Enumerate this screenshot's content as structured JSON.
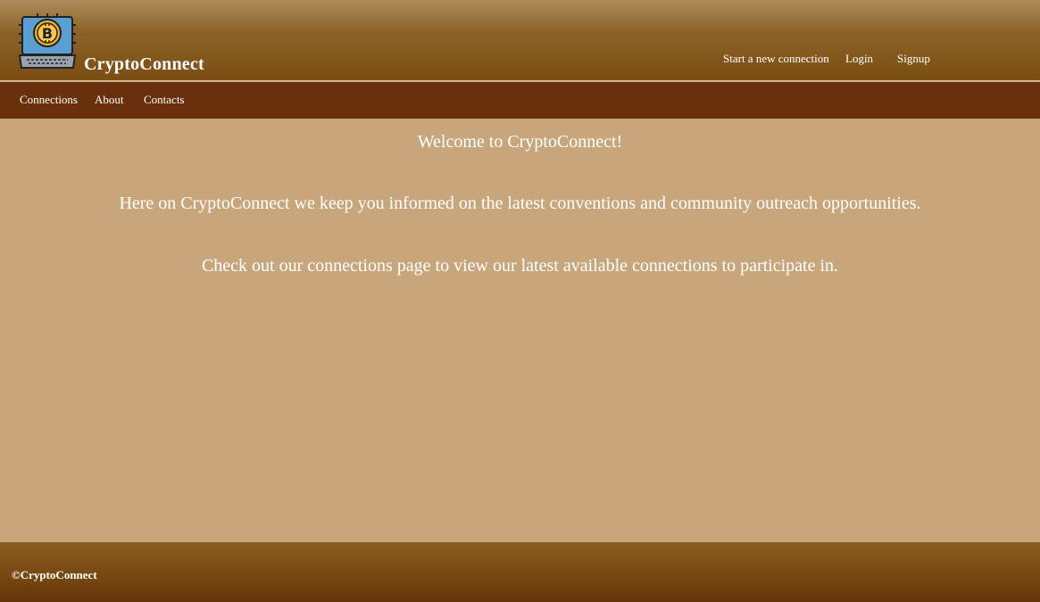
{
  "header": {
    "brand_name": "CryptoConnect",
    "logo_icon": "bitcoin-laptop-icon",
    "links": {
      "new_connection": "Start a new connection",
      "login": "Login",
      "signup": "Signup"
    }
  },
  "nav": {
    "items": [
      {
        "label": "Connections"
      },
      {
        "label": "About"
      },
      {
        "label": "Contacts"
      }
    ]
  },
  "main": {
    "welcome": "Welcome to CryptoConnect!",
    "intro": "Here on CryptoConnect we keep you informed on the latest conventions and community outreach opportunities.",
    "cta": "Check out our connections page to view our latest available connections to participate in."
  },
  "footer": {
    "copyright": "©CryptoConnect"
  },
  "colors": {
    "header_top": "#ae8b5c",
    "header_bottom": "#7a4e12",
    "nav_bg": "#69300c",
    "body_bg": "#c8a67b",
    "coin": "#f5b324",
    "laptop": "#5a9fd4"
  }
}
